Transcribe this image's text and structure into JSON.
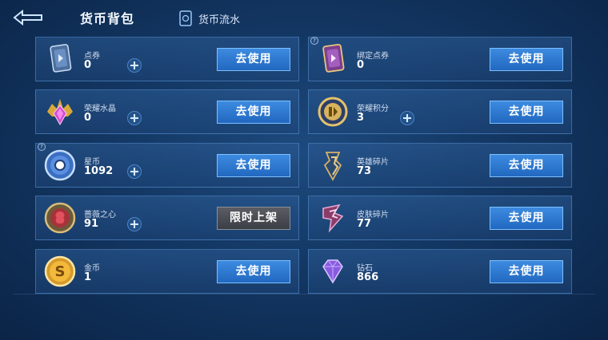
{
  "header": {
    "title": "货币背包",
    "flow_tab_label": "货币流水"
  },
  "use_label": "去使用",
  "limited_label": "限时上架",
  "currencies": [
    {
      "name": "点券",
      "count": "0"
    },
    {
      "name": "绑定点券",
      "count": "0"
    },
    {
      "name": "荣耀水晶",
      "count": "0"
    },
    {
      "name": "荣耀积分",
      "count": "3"
    },
    {
      "name": "星币",
      "count": "1092"
    },
    {
      "name": "英雄碎片",
      "count": "73"
    },
    {
      "name": "蔷薇之心",
      "count": "91"
    },
    {
      "name": "皮肤碎片",
      "count": "77"
    },
    {
      "name": "金币",
      "count": "1"
    },
    {
      "name": "钻石",
      "count": "866"
    }
  ],
  "colors": {
    "button_blue": "#2f7ad3",
    "button_gray": "#4a4d53",
    "card_border": "#4f86c4"
  }
}
